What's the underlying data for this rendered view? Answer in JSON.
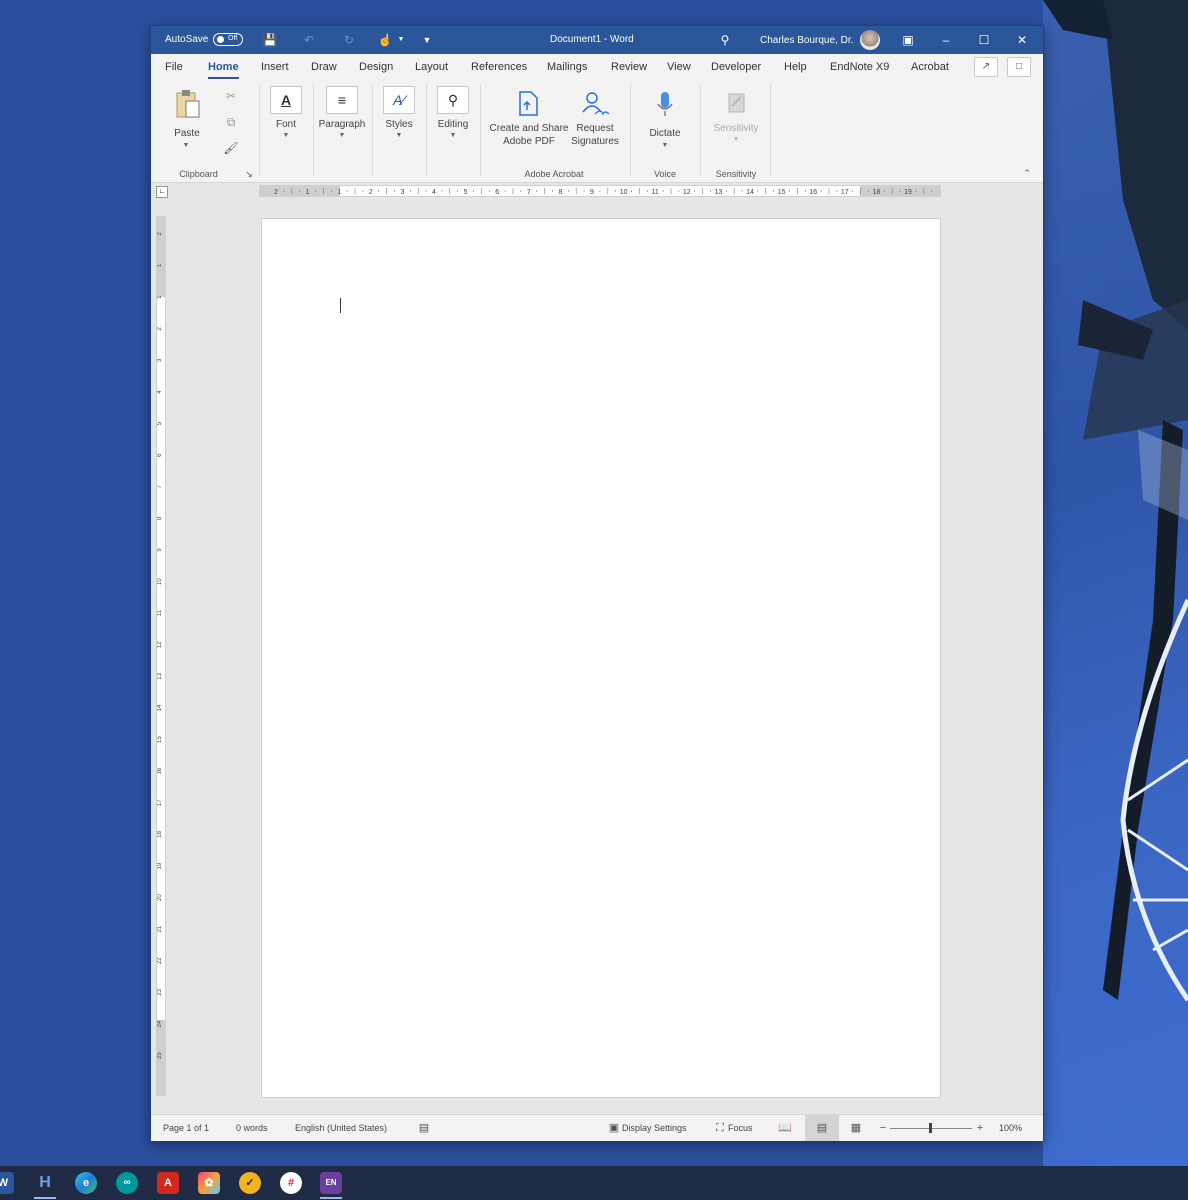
{
  "titlebar": {
    "autosave_label": "AutoSave",
    "autosave_state": "Off",
    "document_title": "Document1  -  Word",
    "user_name": "Charles Bourque, Dr."
  },
  "menu": {
    "items": [
      "File",
      "Home",
      "Insert",
      "Draw",
      "Design",
      "Layout",
      "References",
      "Mailings",
      "Review",
      "View",
      "Developer",
      "Help",
      "EndNote X9",
      "Acrobat"
    ],
    "active": "Home"
  },
  "ribbon": {
    "clipboard": {
      "paste_label": "Paste",
      "group_label": "Clipboard"
    },
    "font_label": "Font",
    "paragraph_label": "Paragraph",
    "styles_label": "Styles",
    "editing_label": "Editing",
    "acrobat": {
      "create_label_1": "Create and Share",
      "create_label_2": "Adobe PDF",
      "request_label_1": "Request",
      "request_label_2": "Signatures",
      "group_label": "Adobe Acrobat"
    },
    "voice": {
      "dictate_label": "Dictate",
      "group_label": "Voice"
    },
    "sensitivity": {
      "button_label": "Sensitivity",
      "group_label": "Sensitivity"
    }
  },
  "ruler": {
    "h_ticks": [
      "2",
      "1",
      "1",
      "2",
      "3",
      "4",
      "5",
      "6",
      "7",
      "8",
      "9",
      "10",
      "11",
      "12",
      "13",
      "14",
      "15",
      "16",
      "17",
      "18",
      "19"
    ],
    "v_ticks": [
      "2",
      "1",
      "1",
      "2",
      "3",
      "4",
      "5",
      "6",
      "7",
      "8",
      "9",
      "10",
      "11",
      "12",
      "13",
      "14",
      "15",
      "16",
      "17",
      "18",
      "19",
      "20",
      "21",
      "22",
      "23",
      "24",
      "25"
    ]
  },
  "status": {
    "page": "Page 1 of 1",
    "words": "0 words",
    "language": "English (United States)",
    "display_settings": "Display Settings",
    "focus": "Focus",
    "zoom": "100%"
  },
  "taskbar": {
    "apps": [
      "word",
      "hyper",
      "edge",
      "arduino",
      "acrobat",
      "photos",
      "norton",
      "slack",
      "endnote"
    ],
    "endnote_label": "EN"
  },
  "colors": {
    "word_blue": "#2b579a",
    "desktop": "#2b4f9c"
  }
}
